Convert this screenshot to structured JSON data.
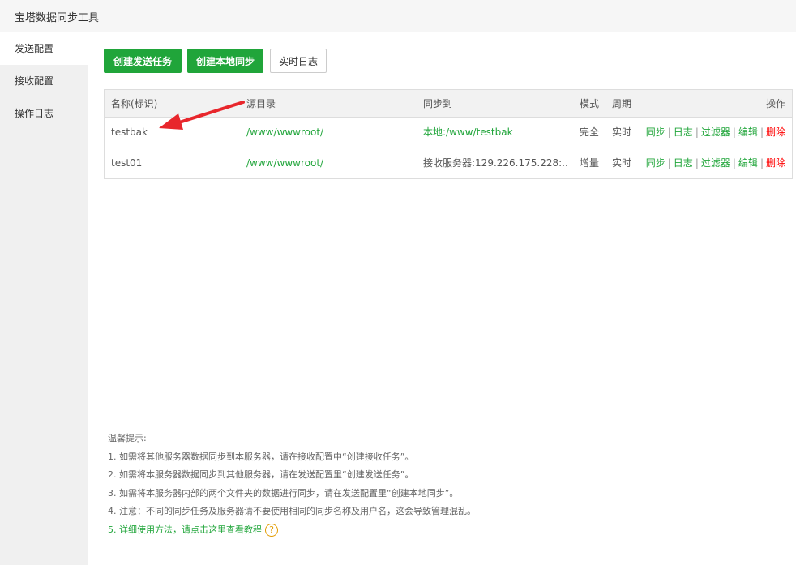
{
  "window": {
    "title": "宝塔数据同步工具"
  },
  "sidebar": {
    "items": [
      {
        "label": "发送配置",
        "active": true
      },
      {
        "label": "接收配置",
        "active": false
      },
      {
        "label": "操作日志",
        "active": false
      }
    ]
  },
  "toolbar": {
    "create_send_label": "创建发送任务",
    "create_local_label": "创建本地同步",
    "realtime_log_label": "实时日志"
  },
  "table": {
    "headers": {
      "name": "名称(标识)",
      "source": "源目录",
      "target": "同步到",
      "mode": "模式",
      "period": "周期",
      "actions": "操作"
    },
    "rows": [
      {
        "name": "testbak",
        "source": "/www/wwwroot/",
        "target": "本地:/www/testbak",
        "mode": "完全",
        "period": "实时"
      },
      {
        "name": "test01",
        "source": "/www/wwwroot/",
        "target": "接收服务器:129.226.175.228:...",
        "mode": "增量",
        "period": "实时"
      }
    ],
    "actions": {
      "sync": "同步",
      "log": "日志",
      "filter": "过滤器",
      "edit": "编辑",
      "delete": "删除"
    }
  },
  "tips": {
    "title": "温馨提示:",
    "lines": [
      "1. 如需将其他服务器数据同步到本服务器，请在接收配置中“创建接收任务”。",
      "2. 如需将本服务器数据同步到其他服务器，请在发送配置里“创建发送任务”。",
      "3. 如需将本服务器内部的两个文件夹的数据进行同步，请在发送配置里“创建本地同步”。",
      "4. 注意：不同的同步任务及服务器请不要使用相同的同步名称及用户名，这会导致管理混乱。"
    ],
    "link_prefix": "5. ",
    "link_text": "详细使用方法，请点击这里查看教程",
    "help_glyph": "?"
  },
  "colors": {
    "accent": "#20a53a",
    "danger": "#ff0000",
    "help": "#e39c00",
    "annotation_arrow": "#e8262c"
  }
}
